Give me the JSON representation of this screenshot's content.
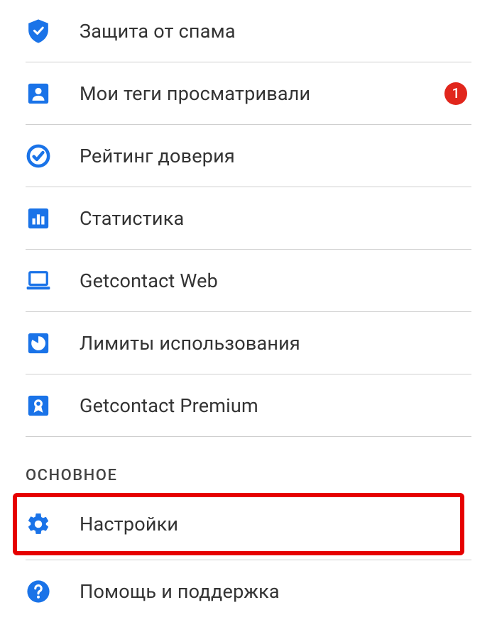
{
  "colors": {
    "accent": "#1a73e8",
    "badge": "#e1261c",
    "highlight_border": "#e60000"
  },
  "menu": {
    "items": [
      {
        "icon": "shield-check-icon",
        "label": "Защита от спама",
        "badge": null
      },
      {
        "icon": "person-card-icon",
        "label": "Мои теги просматривали",
        "badge": "1"
      },
      {
        "icon": "check-circle-icon",
        "label": "Рейтинг доверия",
        "badge": null
      },
      {
        "icon": "bar-chart-icon",
        "label": "Статистика",
        "badge": null
      },
      {
        "icon": "laptop-icon",
        "label": "Getcontact Web",
        "badge": null
      },
      {
        "icon": "pie-chart-icon",
        "label": "Лимиты использования",
        "badge": null
      },
      {
        "icon": "medal-icon",
        "label": "Getcontact Premium",
        "badge": null
      }
    ]
  },
  "section": {
    "title": "ОСНОВНОЕ",
    "items": [
      {
        "icon": "gear-icon",
        "label": "Настройки",
        "highlight": true
      },
      {
        "icon": "help-icon",
        "label": "Помощь и поддержка",
        "highlight": false
      }
    ]
  }
}
